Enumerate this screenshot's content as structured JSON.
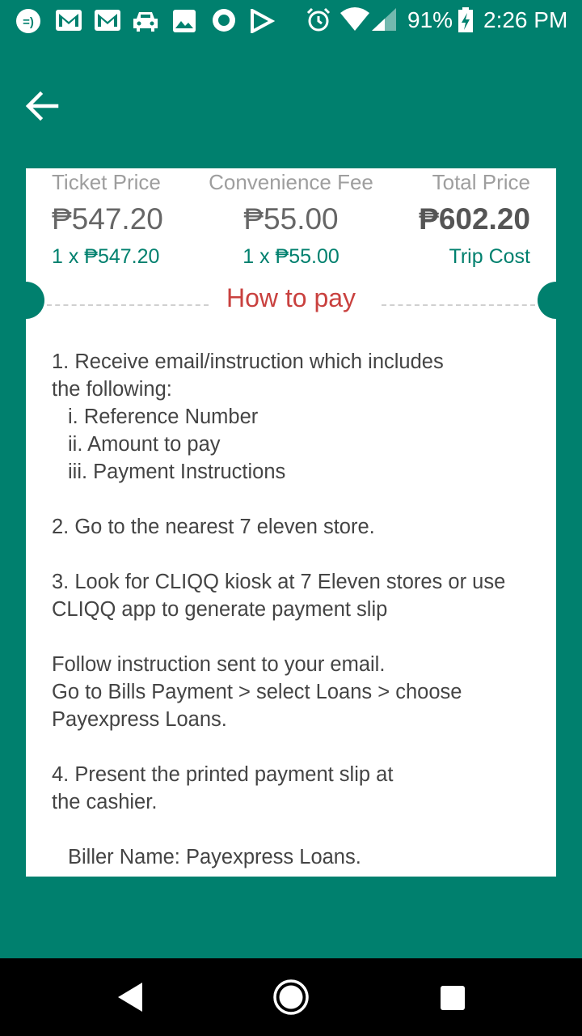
{
  "status_bar": {
    "battery": "91%",
    "time": "2:26 PM",
    "icons": [
      "messenger-icon",
      "gmail-icon",
      "gmail-icon",
      "car-icon",
      "image-icon",
      "record-icon",
      "play-icon",
      "alarm-icon",
      "wifi-icon",
      "signal-icon",
      "battery-charging-icon"
    ]
  },
  "header": {
    "back_icon": "arrow-left-icon"
  },
  "prices": {
    "ticket": {
      "label": "Ticket Price",
      "value": "₱547.20",
      "sub": "1 x ₱547.20"
    },
    "fee": {
      "label": "Convenience Fee",
      "value": "₱55.00",
      "sub": "1 x ₱55.00"
    },
    "total": {
      "label": "Total Price",
      "value": "₱602.20",
      "sub": "Trip Cost"
    }
  },
  "how_to_pay": {
    "title": "How to pay",
    "lines": {
      "l1": "1. Receive email/instruction which includes",
      "l2": "the following:",
      "l3": "i. Reference Number",
      "l4": "ii. Amount to pay",
      "l5": "iii. Payment Instructions",
      "l6": "2. Go to the nearest 7 eleven store.",
      "l7": "3. Look for CLIQQ kiosk at 7 Eleven stores or use",
      "l8": "CLIQQ app to generate payment slip",
      "l9": "Follow instruction sent to your email.",
      "l10": "Go to Bills Payment > select Loans > choose",
      "l11": "Payexpress Loans.",
      "l12": "4. Present the printed payment slip at",
      "l13": "the cashier.",
      "l14": "Biller Name: Payexpress Loans."
    }
  },
  "colors": {
    "primary": "#00806e",
    "accent": "#c9413f",
    "card": "#ffffff"
  },
  "nav": {
    "back": "nav-back-icon",
    "home": "nav-home-icon",
    "recents": "nav-recents-icon"
  }
}
